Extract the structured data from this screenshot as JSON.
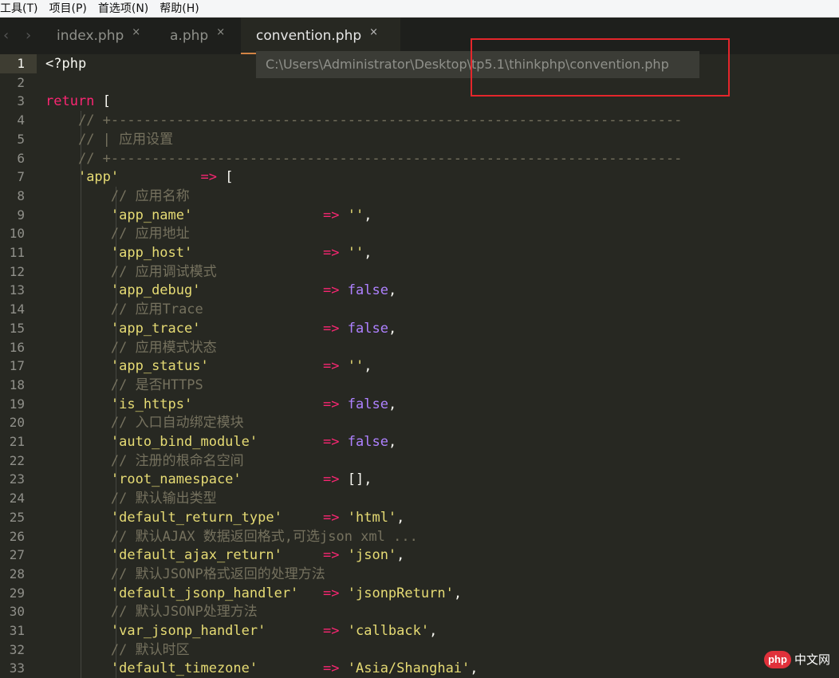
{
  "menu": [
    "工具(T)",
    "项目(P)",
    "首选项(N)",
    "帮助(H)"
  ],
  "tabs": [
    {
      "label": "index.php",
      "close": "×"
    },
    {
      "label": "a.php",
      "close": "×"
    },
    {
      "label": "convention.php",
      "close": "×"
    }
  ],
  "nav": {
    "back": "‹",
    "forward": "›"
  },
  "tooltip": "C:\\Users\\Administrator\\Desktop\\tp5.1\\thinkphp\\convention.php",
  "editor": {
    "line_numbers": [
      "1",
      "2",
      "3",
      "4",
      "5",
      "6",
      "7",
      "8",
      "9",
      "10",
      "11",
      "12",
      "13",
      "14",
      "15",
      "16",
      "17",
      "18",
      "19",
      "20",
      "21",
      "22",
      "23",
      "24",
      "25",
      "26",
      "27",
      "28",
      "29",
      "30",
      "31",
      "32",
      "33"
    ],
    "lines": [
      "<?php",
      "",
      "return [",
      "    // +----------------------------------------------------------------------",
      "    // | 应用设置",
      "    // +----------------------------------------------------------------------",
      "    'app'          => [",
      "        // 应用名称",
      "        'app_name'                => '',",
      "        // 应用地址",
      "        'app_host'                => '',",
      "        // 应用调试模式",
      "        'app_debug'               => false,",
      "        // 应用Trace",
      "        'app_trace'               => false,",
      "        // 应用模式状态",
      "        'app_status'              => '',",
      "        // 是否HTTPS",
      "        'is_https'                => false,",
      "        // 入口自动绑定模块",
      "        'auto_bind_module'        => false,",
      "        // 注册的根命名空间",
      "        'root_namespace'          => [],",
      "        // 默认输出类型",
      "        'default_return_type'     => 'html',",
      "        // 默认AJAX 数据返回格式,可选json xml ...",
      "        'default_ajax_return'     => 'json',",
      "        // 默认JSONP格式返回的处理方法",
      "        'default_jsonp_handler'   => 'jsonpReturn',",
      "        // 默认JSONP处理方法",
      "        'var_jsonp_handler'       => 'callback',",
      "        // 默认时区",
      "        'default_timezone'        => 'Asia/Shanghai',"
    ]
  },
  "watermark": {
    "logo": "php",
    "text": "中文网"
  },
  "colors": {
    "background": "#272822",
    "keyword": "#f92672",
    "string": "#e6db74",
    "comment": "#75715e",
    "boolean": "#ae81ff",
    "highlight_box": "#e5262b"
  }
}
